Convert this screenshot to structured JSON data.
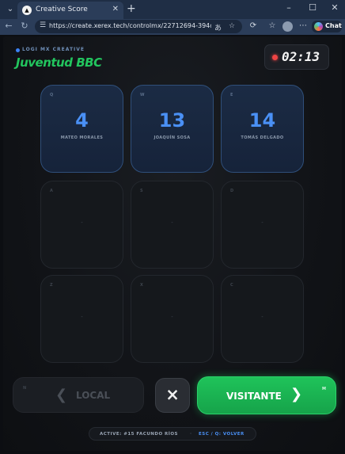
{
  "browser": {
    "tab_title": "Creative Score",
    "url": "https://create.xerex.tech/controlmx/22712694-394d-49e1-b...",
    "chat_label": "Chat"
  },
  "header": {
    "brand": "LOGI MX CREATIVE",
    "team_name": "Juventud BBC",
    "timer": "02:13"
  },
  "tiles": [
    {
      "key": "Q",
      "number": "4",
      "name": "MATEO MORALES"
    },
    {
      "key": "W",
      "number": "13",
      "name": "JOAQUÍN SOSA"
    },
    {
      "key": "E",
      "number": "14",
      "name": "TOMÁS DELGADO"
    },
    {
      "key": "A",
      "placeholder": "-"
    },
    {
      "key": "S",
      "placeholder": "-"
    },
    {
      "key": "D",
      "placeholder": "-"
    },
    {
      "key": "Z",
      "placeholder": "-"
    },
    {
      "key": "X",
      "placeholder": "-"
    },
    {
      "key": "C",
      "placeholder": "-"
    }
  ],
  "actions": {
    "local_key": "N",
    "local_label": "LOCAL",
    "cancel_icon": "×",
    "visitante_label": "VISITANTE",
    "visitante_key": "M"
  },
  "status": {
    "active": "ACTIVE: #15 FACUNDO RÍOS",
    "separator": "·",
    "hint": "ESC / Q: VOLVER"
  },
  "colors": {
    "accent_green": "#22c55e",
    "accent_blue": "#4a90f5",
    "record_red": "#ef4444"
  }
}
